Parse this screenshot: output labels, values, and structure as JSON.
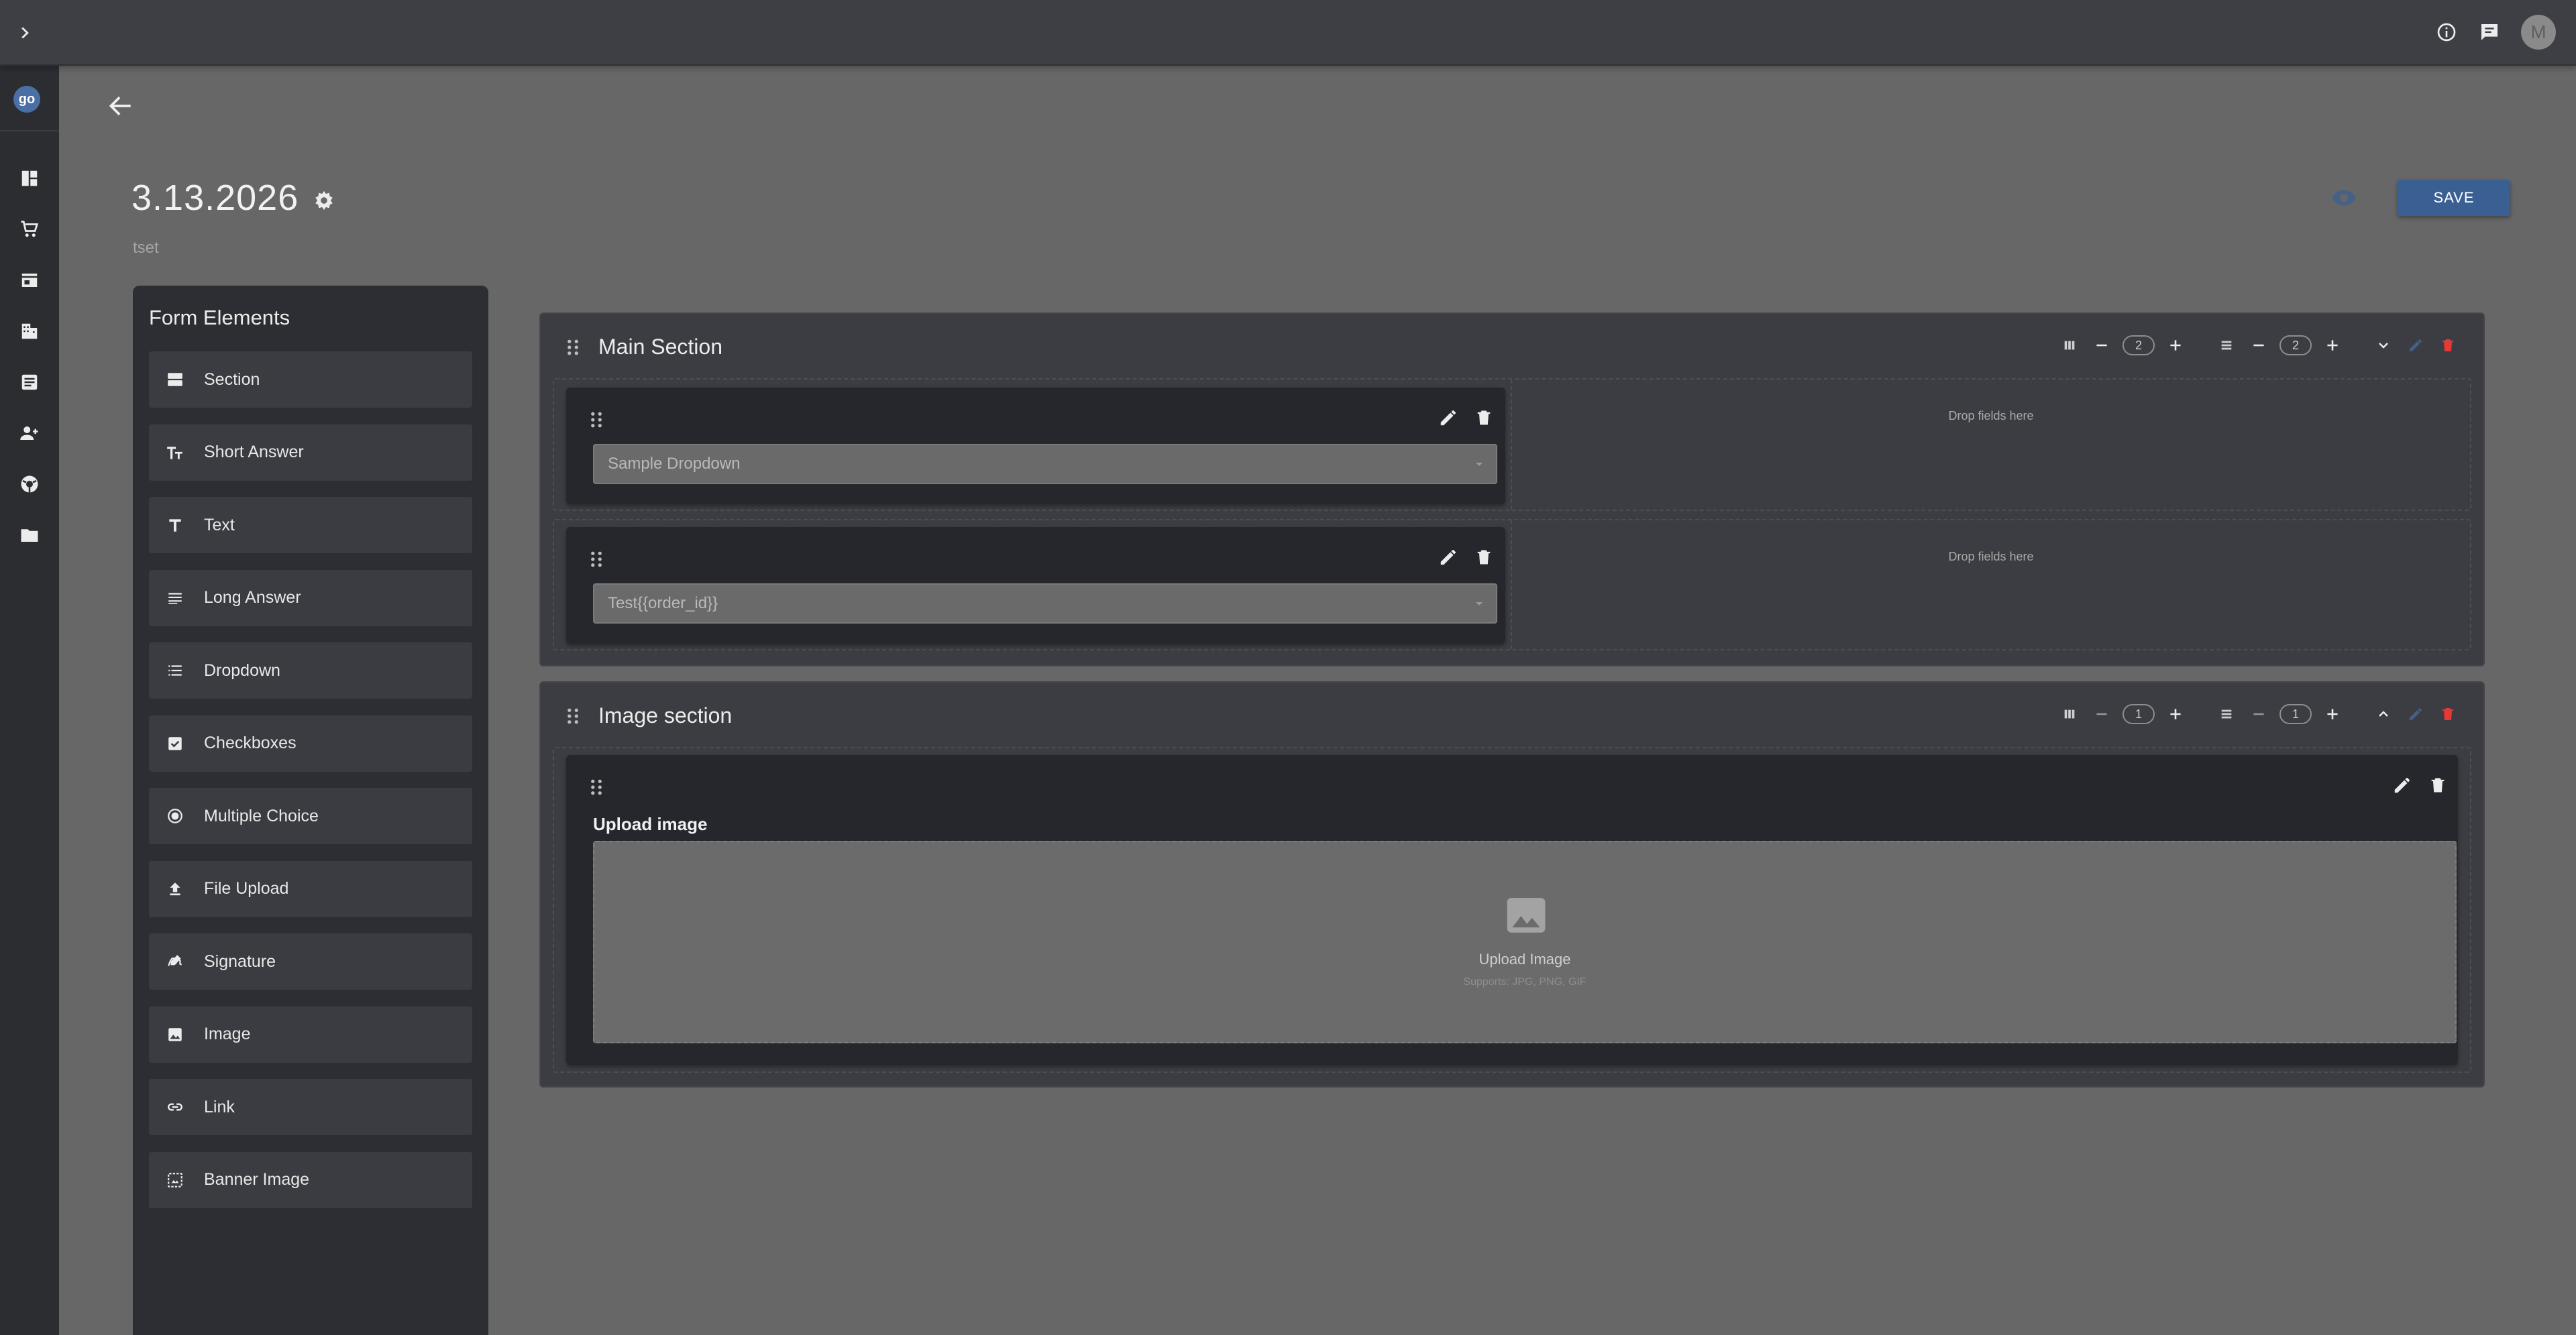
{
  "topbar": {
    "expand_icon": "chevron-right-icon",
    "info_icon": "info-icon",
    "feedback_icon": "feedback-icon",
    "avatar_initial": "M"
  },
  "rail": {
    "logo_text": "go",
    "items": [
      {
        "icon": "dashboard-icon"
      },
      {
        "icon": "cart-icon"
      },
      {
        "icon": "store-icon"
      },
      {
        "icon": "building-icon"
      },
      {
        "icon": "document-icon"
      },
      {
        "icon": "add-user-icon"
      },
      {
        "icon": "support-icon"
      },
      {
        "icon": "folder-icon"
      }
    ]
  },
  "header": {
    "title": "3.13.2026",
    "subtitle": "tset",
    "save_label": "SAVE"
  },
  "palette": {
    "title": "Form Elements",
    "items": [
      {
        "label": "Section",
        "icon": "section-icon"
      },
      {
        "label": "Short Answer",
        "icon": "text-size-icon"
      },
      {
        "label": "Text",
        "icon": "text-t-icon"
      },
      {
        "label": "Long Answer",
        "icon": "long-text-icon"
      },
      {
        "label": "Dropdown",
        "icon": "list-icon"
      },
      {
        "label": "Checkboxes",
        "icon": "checkbox-icon"
      },
      {
        "label": "Multiple Choice",
        "icon": "radio-icon"
      },
      {
        "label": "File Upload",
        "icon": "upload-icon"
      },
      {
        "label": "Signature",
        "icon": "signature-icon"
      },
      {
        "label": "Image",
        "icon": "image-icon"
      },
      {
        "label": "Link",
        "icon": "link-icon"
      },
      {
        "label": "Banner Image",
        "icon": "banner-image-icon"
      }
    ]
  },
  "sections": [
    {
      "title": "Main Section",
      "columns": "2",
      "rows": "2",
      "collapse_icon": "chevron-down-icon",
      "fields": [
        {
          "value": "Sample Dropdown",
          "drop_text": "Drop fields here"
        },
        {
          "value": "Test{{order_id}}",
          "drop_text": "Drop fields here"
        }
      ]
    },
    {
      "title": "Image section",
      "columns": "1",
      "rows": "1",
      "collapse_icon": "chevron-up-icon",
      "upload": {
        "label": "Upload image",
        "button_text": "Upload Image",
        "hint": "Supports: JPG, PNG, GIF"
      }
    }
  ],
  "colors": {
    "accent": "#3a5f93",
    "danger": "#e53935",
    "panel": "#2c2e33",
    "section": "#3b3d42",
    "card": "#25272c"
  }
}
